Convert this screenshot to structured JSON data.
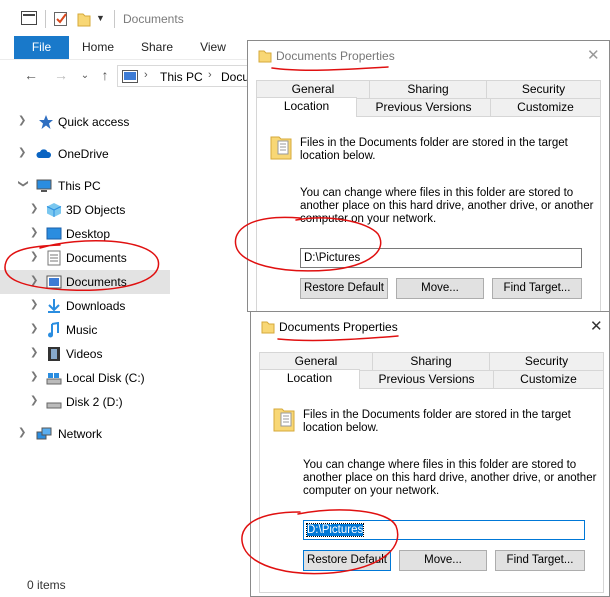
{
  "explorer": {
    "window_title": "Documents",
    "ribbon_tabs": [
      "File",
      "Home",
      "Share",
      "View"
    ],
    "address": {
      "crumbs": [
        "This PC",
        "Docu"
      ]
    },
    "nav_items": [
      {
        "label": "Quick access",
        "icon": "star-icon"
      },
      {
        "label": "OneDrive",
        "icon": "cloud-icon"
      },
      {
        "label": "This PC",
        "icon": "computer-icon"
      },
      {
        "label": "3D Objects",
        "icon": "cube-icon"
      },
      {
        "label": "Desktop",
        "icon": "desktop-icon"
      },
      {
        "label": "Documents",
        "icon": "document-icon"
      },
      {
        "label": "Documents",
        "icon": "pictures-icon"
      },
      {
        "label": "Downloads",
        "icon": "download-icon"
      },
      {
        "label": "Music",
        "icon": "music-icon"
      },
      {
        "label": "Videos",
        "icon": "film-icon"
      },
      {
        "label": "Local Disk (C:)",
        "icon": "drive-icon"
      },
      {
        "label": "Disk 2 (D:)",
        "icon": "drive-icon"
      },
      {
        "label": "Network",
        "icon": "network-icon"
      }
    ],
    "status": "0 items"
  },
  "dialog1": {
    "title": "Documents Properties",
    "tabs_top": [
      "General",
      "Sharing",
      "Security"
    ],
    "tabs_bottom": [
      "Location",
      "Previous Versions",
      "Customize"
    ],
    "info_line1": "Files in the Documents folder are stored in the target",
    "info_line2": "location below.",
    "change_line1": "You can change where files in this folder are stored to",
    "change_line2": "another place on this hard drive, another drive, or another",
    "change_line3": "computer on your network.",
    "path_value": "D:\\Pictures",
    "btn_restore": "Restore Default",
    "btn_move": "Move...",
    "btn_find": "Find Target..."
  },
  "dialog2": {
    "title": "Documents Properties",
    "tabs_top": [
      "General",
      "Sharing",
      "Security"
    ],
    "tabs_bottom": [
      "Location",
      "Previous Versions",
      "Customize"
    ],
    "info_line1": "Files in the Documents folder are stored in the target",
    "info_line2": "location below.",
    "change_line1": "You can change where files in this folder are stored to",
    "change_line2": "another place on this hard drive, another drive, or another",
    "change_line3": "computer on your network.",
    "path_value": "D:\\Pictures",
    "btn_restore": "Restore Default",
    "btn_move": "Move...",
    "btn_find": "Find Target..."
  },
  "colors": {
    "accent": "#1979ca",
    "annotation": "#e01010",
    "selection": "#0078d7"
  }
}
